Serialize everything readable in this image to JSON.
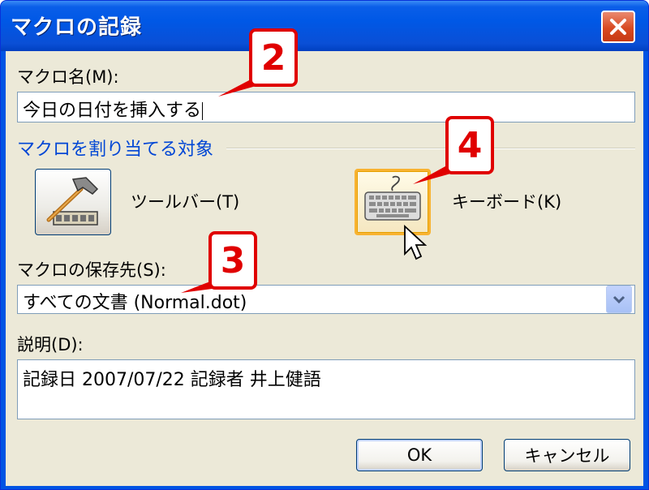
{
  "window": {
    "title": "マクロの記録",
    "close_icon": "close-icon"
  },
  "macro_name": {
    "label": "マクロ名(M):",
    "value": "今日の日付を挿入する"
  },
  "assign": {
    "section_label": "マクロを割り当てる対象",
    "toolbar_label": "ツールバー(T)",
    "toolbar_icon": "hammer-toolbar-icon",
    "keyboard_label": "キーボード(K)",
    "keyboard_icon": "keyboard-icon"
  },
  "store": {
    "label": "マクロの保存先(S):",
    "value": "すべての文書 (Normal.dot)"
  },
  "description": {
    "label": "説明(D):",
    "value": "記録日 2007/07/22 記録者 井上健語"
  },
  "buttons": {
    "ok": "OK",
    "cancel": "キャンセル"
  },
  "callouts": {
    "c2": "2",
    "c3": "3",
    "c4": "4"
  },
  "colors": {
    "titlebar": "#0054e3",
    "section_text": "#0046d5",
    "callout": "#e00000",
    "hot_border": "#f8b332"
  }
}
